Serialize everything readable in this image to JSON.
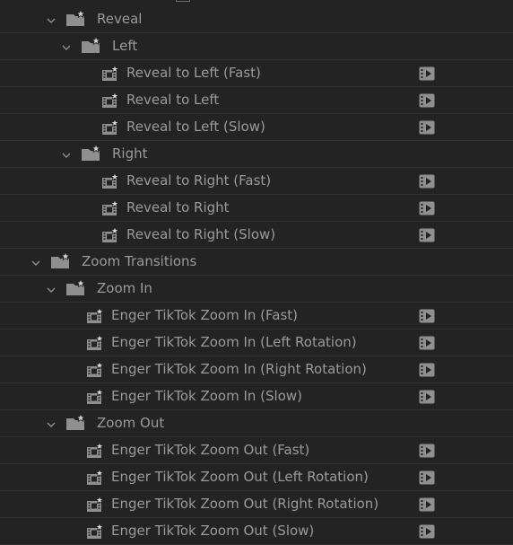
{
  "tree": [
    {
      "kind": "folder",
      "level": 2,
      "label": "Reveal",
      "expanded": true
    },
    {
      "kind": "folder",
      "level": 3,
      "label": "Left",
      "expanded": true
    },
    {
      "kind": "preset",
      "level": 4,
      "label": "Reveal to Left (Fast)"
    },
    {
      "kind": "preset",
      "level": 4,
      "label": "Reveal to Left"
    },
    {
      "kind": "preset",
      "level": 4,
      "label": "Reveal to Left (Slow)"
    },
    {
      "kind": "folder",
      "level": 3,
      "label": "Right",
      "expanded": true
    },
    {
      "kind": "preset",
      "level": 4,
      "label": "Reveal to Right (Fast)"
    },
    {
      "kind": "preset",
      "level": 4,
      "label": "Reveal to Right"
    },
    {
      "kind": "preset",
      "level": 4,
      "label": "Reveal to Right (Slow)"
    },
    {
      "kind": "folder",
      "level": 1,
      "label": "Zoom Transitions",
      "expanded": true
    },
    {
      "kind": "folder",
      "level": 2,
      "label": "Zoom In",
      "expanded": true
    },
    {
      "kind": "preset",
      "level": 3,
      "label": "Enger TikTok Zoom In (Fast)"
    },
    {
      "kind": "preset",
      "level": 3,
      "label": "Enger TikTok Zoom In (Left Rotation)"
    },
    {
      "kind": "preset",
      "level": 3,
      "label": "Enger TikTok Zoom In (Right Rotation)"
    },
    {
      "kind": "preset",
      "level": 3,
      "label": "Enger TikTok Zoom In (Slow)"
    },
    {
      "kind": "folder",
      "level": 2,
      "label": "Zoom Out",
      "expanded": true
    },
    {
      "kind": "preset",
      "level": 3,
      "label": "Enger TikTok Zoom Out (Fast)"
    },
    {
      "kind": "preset",
      "level": 3,
      "label": "Enger TikTok Zoom Out (Left Rotation)"
    },
    {
      "kind": "preset",
      "level": 3,
      "label": "Enger TikTok Zoom Out (Right Rotation)"
    },
    {
      "kind": "preset",
      "level": 3,
      "label": "Enger TikTok Zoom Out (Slow)"
    }
  ],
  "icons": {
    "folder": "preset-bin-folder-icon",
    "preset": "video-transition-preset-icon",
    "badge": "accelerated-effect-badge-icon",
    "expanded": "chevron-down-icon"
  },
  "colors": {
    "background": "#232323",
    "text": "#9a9a9a",
    "icon": "#8f8f8f",
    "row_divider": "#303030"
  }
}
